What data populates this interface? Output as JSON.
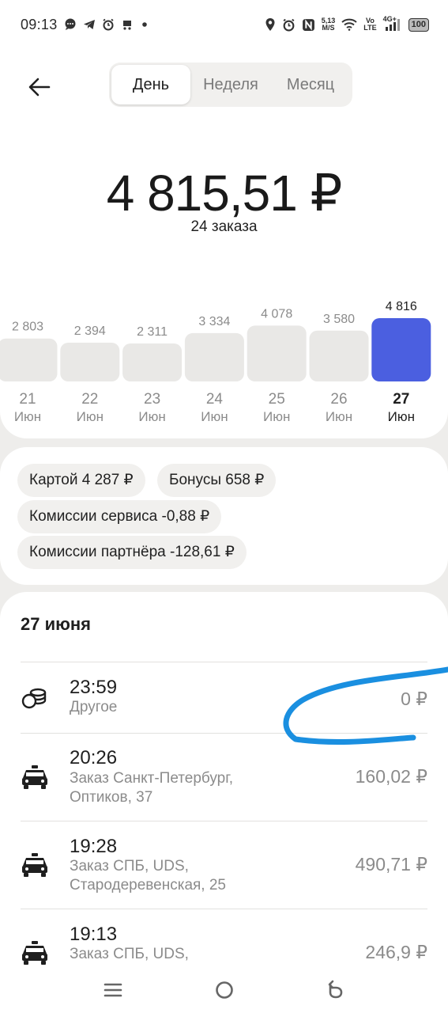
{
  "status_bar": {
    "time": "09:13",
    "left_icons": [
      "chat-bubble-icon",
      "telegram-icon",
      "alarm-icon",
      "cart-icon",
      "dot-icon"
    ],
    "speed_value": "5,13",
    "speed_unit": "M/S",
    "net_top": "Vo",
    "net_bottom": "LTE",
    "signal_label": "4G+",
    "battery": "100"
  },
  "header": {
    "tabs": [
      {
        "label": "День",
        "active": true
      },
      {
        "label": "Неделя",
        "active": false
      },
      {
        "label": "Месяц",
        "active": false
      }
    ]
  },
  "summary": {
    "total": "4 815,51 ₽",
    "orders": "24 заказа"
  },
  "chart_data": {
    "type": "bar",
    "categories": [
      "21 Июн",
      "22 Июн",
      "23 Июн",
      "24 Июн",
      "25 Июн",
      "26 Июн",
      "27 Июн"
    ],
    "days": [
      "21",
      "22",
      "23",
      "24",
      "25",
      "26",
      "27"
    ],
    "months": [
      "Июн",
      "Июн",
      "Июн",
      "Июн",
      "Июн",
      "Июн",
      "Июн"
    ],
    "values": [
      2803,
      2394,
      2311,
      3334,
      4078,
      3580,
      4816
    ],
    "value_labels": [
      "2 803",
      "2 394",
      "2 311",
      "3 334",
      "4 078",
      "3 580",
      "4 816"
    ],
    "selected_index": 6,
    "bar_color": "#e9e8e6",
    "selected_color": "#4b5fe0"
  },
  "breakdown": {
    "card": "Картой 4 287 ₽",
    "bonus": "Бонусы 658 ₽",
    "service_fee": "Комиссии сервиса -0,88 ₽",
    "partner_fee": "Комиссии партнёра -128,61 ₽"
  },
  "transactions": {
    "date": "27 июня",
    "items": [
      {
        "time": "23:59",
        "desc": "Другое",
        "amount": "0 ₽",
        "icon": "coins-icon"
      },
      {
        "time": "20:26",
        "desc": "Заказ Санкт-Петербург, Оптиков, 37",
        "amount": "160,02 ₽",
        "icon": "taxi-icon"
      },
      {
        "time": "19:28",
        "desc": "Заказ СПБ, UDS, Стародеревенская, 25",
        "amount": "490,71 ₽",
        "icon": "taxi-icon"
      },
      {
        "time": "19:13",
        "desc": "Заказ СПБ, UDS,",
        "amount": "246,9 ₽",
        "icon": "taxi-icon"
      }
    ]
  },
  "annotation_color": "#1a8fe0",
  "nav": [
    "menu-icon",
    "home-icon",
    "back-icon"
  ]
}
